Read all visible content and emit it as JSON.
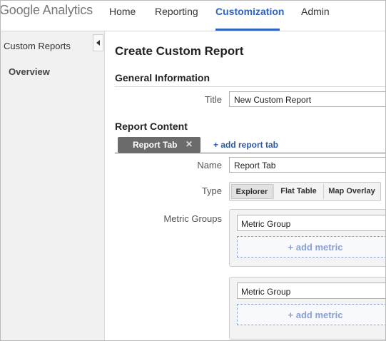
{
  "header": {
    "logo": {
      "google": "Google",
      "analytics": "Analytics"
    },
    "nav": [
      {
        "label": "Home"
      },
      {
        "label": "Reporting"
      },
      {
        "label": "Customization"
      },
      {
        "label": "Admin"
      }
    ],
    "active_nav": "Customization"
  },
  "sidebar": {
    "link": "Custom Reports",
    "overview": "Overview",
    "collapse_icon": "chevron-left-icon"
  },
  "main": {
    "page_title": "Create Custom Report",
    "general": {
      "heading": "General Information",
      "title_label": "Title",
      "title_value": "New Custom Report"
    },
    "content": {
      "heading": "Report Content",
      "tab_label": "Report Tab",
      "tab_close_icon": "close-icon",
      "add_tab": "+ add report tab",
      "name_label": "Name",
      "name_value": "Report Tab",
      "type_label": "Type",
      "types": [
        {
          "label": "Explorer",
          "selected": true
        },
        {
          "label": "Flat Table",
          "selected": false
        },
        {
          "label": "Map Overlay",
          "selected": false
        }
      ],
      "metric_groups_label": "Metric Groups",
      "metric_groups": [
        {
          "name": "Metric Group",
          "add_label": "+ add metric"
        },
        {
          "name": "Metric Group",
          "add_label": "+ add metric"
        }
      ]
    }
  },
  "colors": {
    "accent": "#2f64c2",
    "link": "#2b5aa5",
    "tab_chip": "#6b6b6b",
    "sidebar_bg": "#f1f1f1",
    "add_metric_text": "#8aa0d2"
  }
}
